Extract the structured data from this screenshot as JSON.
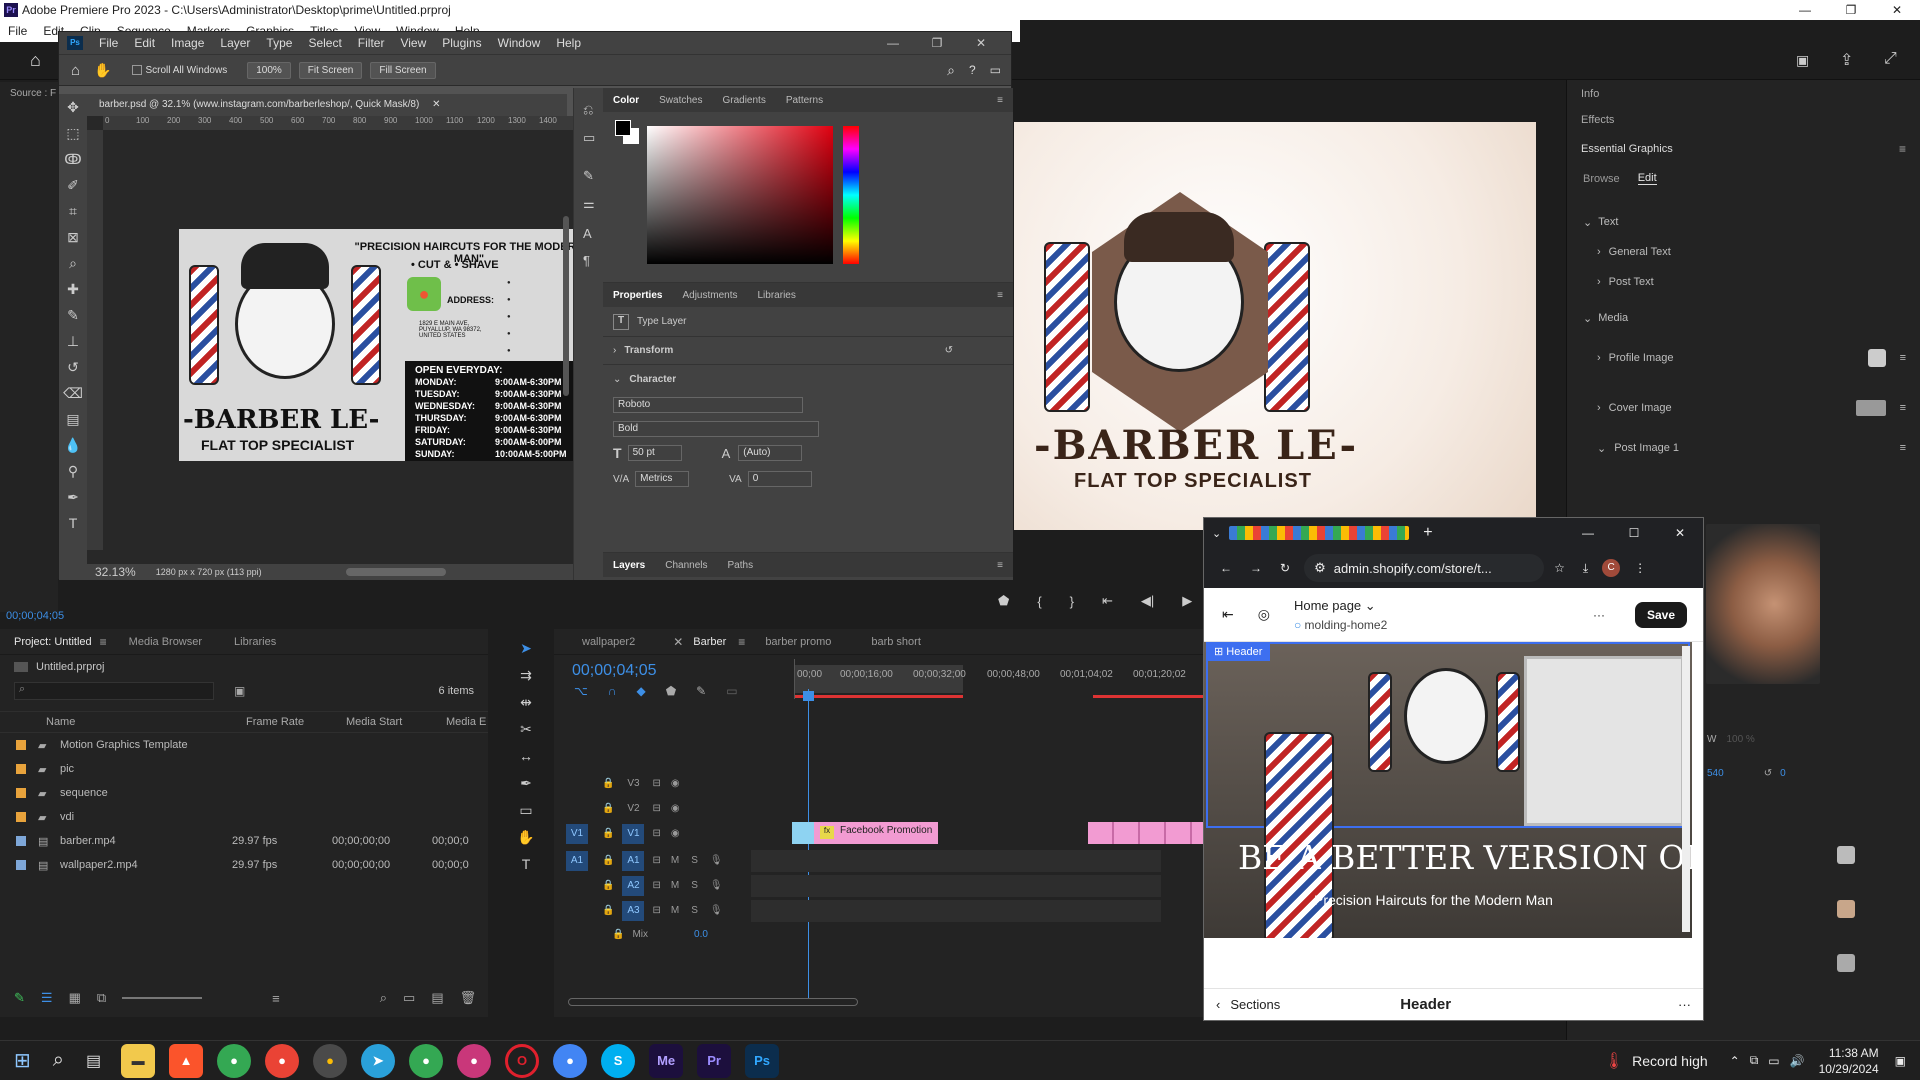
{
  "premiere": {
    "title": "Adobe Premiere Pro 2023 - C:\\Users\\Administrator\\Desktop\\prime\\Untitled.prproj",
    "menu": [
      "File",
      "Edit",
      "Clip",
      "Sequence",
      "Markers",
      "Graphics",
      "Titles",
      "View",
      "Window",
      "Help"
    ],
    "source_label": "Source : F",
    "timecode_source": "00;00;04;05",
    "project": {
      "tabs": [
        "Project: Untitled",
        "Media Browser",
        "Libraries"
      ],
      "file": "Untitled.prproj",
      "items_count": "6 items",
      "columns": [
        "Name",
        "Frame Rate",
        "Media Start",
        "Media E"
      ],
      "rows": [
        {
          "name": "Motion Graphics Template",
          "color": "#e8a33c",
          "fps": "",
          "start": "",
          "end": ""
        },
        {
          "name": "pic",
          "color": "#e8a33c",
          "fps": "",
          "start": "",
          "end": ""
        },
        {
          "name": "sequence",
          "color": "#e8a33c",
          "fps": "",
          "start": "",
          "end": ""
        },
        {
          "name": "vdi",
          "color": "#e8a33c",
          "fps": "",
          "start": "",
          "end": ""
        },
        {
          "name": "barber.mp4",
          "color": "#7ea7d8",
          "fps": "29.97 fps",
          "start": "00;00;00;00",
          "end": "00;00;0"
        },
        {
          "name": "wallpaper2.mp4",
          "color": "#7ea7d8",
          "fps": "29.97 fps",
          "start": "00;00;00;00",
          "end": "00;00;0"
        }
      ]
    },
    "timeline": {
      "tabs": [
        "wallpaper2",
        "Barber",
        "barber promo",
        "barb short"
      ],
      "timecode": "00;00;04;05",
      "ruler": [
        "00;00",
        "00;00;16;00",
        "00;00;32;00",
        "00;00;48;00",
        "00;01;04;02",
        "00;01;20;02"
      ],
      "video_tracks": [
        "V3",
        "V2",
        "V1"
      ],
      "audio_tracks": [
        "A1",
        "A2",
        "A3"
      ],
      "mix_label": "Mix",
      "mix_value": "0.0",
      "clip_label": "Facebook Promotion"
    },
    "right_panel": {
      "items": [
        "Info",
        "Effects",
        "Essential Graphics"
      ],
      "tabs": [
        "Browse",
        "Edit"
      ],
      "text_group": "Text",
      "text_items": [
        "General Text",
        "Post Text"
      ],
      "media_group": "Media",
      "media_items": [
        "Profile Image",
        "Cover Image",
        "Post Image 1"
      ],
      "w_label": "W",
      "w_value": "100 %",
      "pos_value": "540",
      "rot_value": "0"
    }
  },
  "photoshop": {
    "menu": [
      "File",
      "Edit",
      "Image",
      "Layer",
      "Type",
      "Select",
      "Filter",
      "View",
      "Plugins",
      "Window",
      "Help"
    ],
    "options": {
      "scroll_all": "Scroll All Windows",
      "zoom": "100%",
      "fit": "Fit Screen",
      "fill": "Fill Screen"
    },
    "doc_tab": "barber.psd @ 32.1% (www.instagram.com/barberleshop/, Quick Mask/8)",
    "ruler": [
      "0",
      "100",
      "200",
      "300",
      "400",
      "500",
      "600",
      "700",
      "800",
      "900",
      "1000",
      "1100",
      "1200",
      "1300",
      "1400"
    ],
    "status_zoom": "32.13%",
    "status_info": "1280 px x 720 px (113 ppi)",
    "color_tabs": [
      "Color",
      "Swatches",
      "Gradients",
      "Patterns"
    ],
    "prop_tabs": [
      "Properties",
      "Adjustments",
      "Libraries"
    ],
    "type_layer": "Type Layer",
    "transform": "Transform",
    "character": "Character",
    "font": "Roboto",
    "style": "Bold",
    "size": "50 pt",
    "leading": "(Auto)",
    "kerning": "Metrics",
    "tracking": "0",
    "layers_tabs": [
      "Layers",
      "Channels",
      "Paths"
    ],
    "card": {
      "headline": "\"PRECISION HAIRCUTS FOR THE MODERN MAN\"",
      "sub": "• CUT & • SHAVE",
      "address_label": "ADDRESS:",
      "address": "1829 E MAIN AVE, PUYALLUP, WA 98372, UNITED STATES",
      "open": "OPEN EVERYDAY:",
      "hours": [
        [
          "MONDAY:",
          "9:00AM-6:30PM"
        ],
        [
          "TUESDAY:",
          "9:00AM-6:30PM"
        ],
        [
          "WEDNESDAY:",
          "9:00AM-6:30PM"
        ],
        [
          "THURSDAY:",
          "9:00AM-6:30PM"
        ],
        [
          "FRIDAY:",
          "9:00AM-6:30PM"
        ],
        [
          "SATURDAY:",
          "9:00AM-6:00PM"
        ],
        [
          "SUNDAY:",
          "10:00AM-5:00PM"
        ]
      ],
      "brand": "-BARBER LE-",
      "tagline": "FLAT TOP SPECIALIST"
    }
  },
  "preview": {
    "brand": "-BARBER LE-",
    "tagline": "FLAT TOP SPECIALIST"
  },
  "chrome": {
    "url": "admin.shopify.com/store/t...",
    "avatar_letter": "C",
    "page_label": "Home page",
    "template": "molding-home2",
    "save": "Save",
    "header_badge": "Header",
    "hero_text": "BE A BETTER VERSION OF YOU!",
    "hero_sub": "Precision Haircuts for the Modern Man",
    "bottom_back": "Sections",
    "bottom_title": "Header"
  },
  "taskbar": {
    "apps": [
      "explorer",
      "brave",
      "chrome",
      "chrome-2",
      "chrome-3",
      "telegram",
      "chrome-4",
      "chrome-5",
      "opera",
      "chrome-6",
      "skype",
      "media-encoder",
      "premiere",
      "photoshop"
    ],
    "app_labels": {
      "skype": "S",
      "media-encoder": "Me",
      "premiere": "Pr",
      "photoshop": "Ps"
    },
    "record": "Record high",
    "time": "11:38 AM",
    "date": "10/29/2024"
  }
}
